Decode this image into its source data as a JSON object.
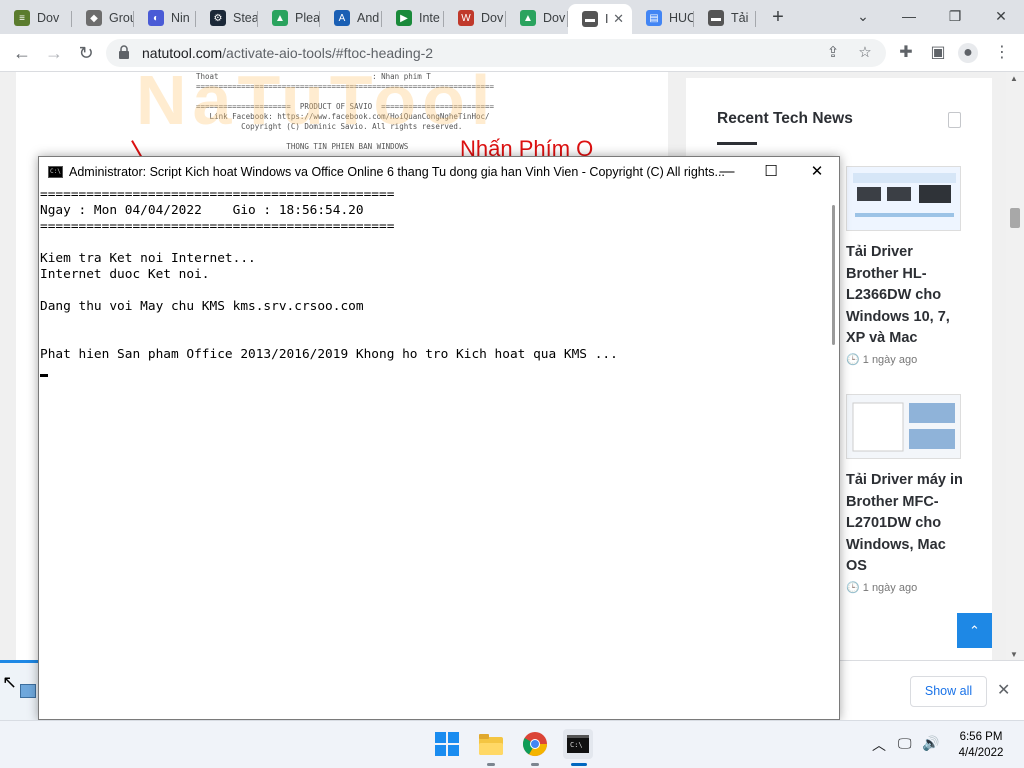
{
  "browser": {
    "tabs": [
      {
        "label": "Dov",
        "icon": "stack-icon",
        "color": "#5b7c2e"
      },
      {
        "label": "Grou",
        "icon": "roblox-icon",
        "color": "#6d6d6d"
      },
      {
        "label": "Nin",
        "icon": "ninja-icon",
        "color": "#4a5bd6"
      },
      {
        "label": "Stea",
        "icon": "steam-icon",
        "color": "#1b2838"
      },
      {
        "label": "Plea",
        "icon": "android-icon",
        "color": "#2aa35e"
      },
      {
        "label": "And",
        "icon": "circle-a-icon",
        "color": "#1a5fb4"
      },
      {
        "label": "Inte",
        "icon": "play-icon",
        "color": "#1a8a3a"
      },
      {
        "label": "Dov",
        "icon": "w-icon",
        "color": "#c0392b"
      },
      {
        "label": "Dov",
        "icon": "android-icon",
        "color": "#2aa35e"
      },
      {
        "label": "I",
        "icon": "site-icon",
        "color": "#555555",
        "active": true
      },
      {
        "label": "HUC",
        "icon": "docs-icon",
        "color": "#4285f4"
      },
      {
        "label": "Tải",
        "icon": "site-icon",
        "color": "#555555"
      }
    ],
    "url_host": "natutool.com",
    "url_path": "/activate-aio-tools/#ftoc-heading-2",
    "new_tab": "+",
    "tab_search": "⌄",
    "minimize": "—",
    "restore": "❐",
    "close": "✕"
  },
  "page": {
    "sidebar_title": "Recent Tech News",
    "news": [
      {
        "title": "Tải Driver Brother HL-L2366DW cho Windows 10, 7, XP và Mac",
        "date": "1 ngày ago"
      },
      {
        "title": "Tải Driver máy in Brother MFC-L2701DW cho Windows, Mac OS",
        "date": "1 ngày ago"
      }
    ],
    "article_lines": [
      "Thoat                                  : Nhan phim T",
      "==================================================================",
      "",
      "=====================  PRODUCT OF SAVIO  =========================",
      "   Link Facebook: https://www.facebook.com/HoiQuanCongNgheTinHoc/",
      "          Copyright (C) Dominic Savio. All rights reserved.",
      "",
      "                    THONG TIN PHIEN BAN WINDOWS"
    ],
    "article_watermark": "NaTuTool",
    "article_callout": "Nhấn Phím Q",
    "show_all": "Show all",
    "back_to_top": "⌃"
  },
  "console": {
    "title": "Administrator:  Script Kich hoat Windows va Office Online 6 thang Tu dong gia han Vinh Vien - Copyright (C) All rights...",
    "lines": [
      "==============================================",
      "Ngay : Mon 04/04/2022    Gio : 18:56:54.20",
      "==============================================",
      "",
      "Kiem tra Ket noi Internet...",
      "Internet duoc Ket noi.",
      "",
      "Dang thu voi May chu KMS kms.srv.crsoo.com",
      "",
      "",
      "Phat hien San pham Office 2013/2016/2019 Khong ho tro Kich hoat qua KMS ..."
    ]
  },
  "taskbar": {
    "time": "6:56 PM",
    "date": "4/4/2022"
  }
}
